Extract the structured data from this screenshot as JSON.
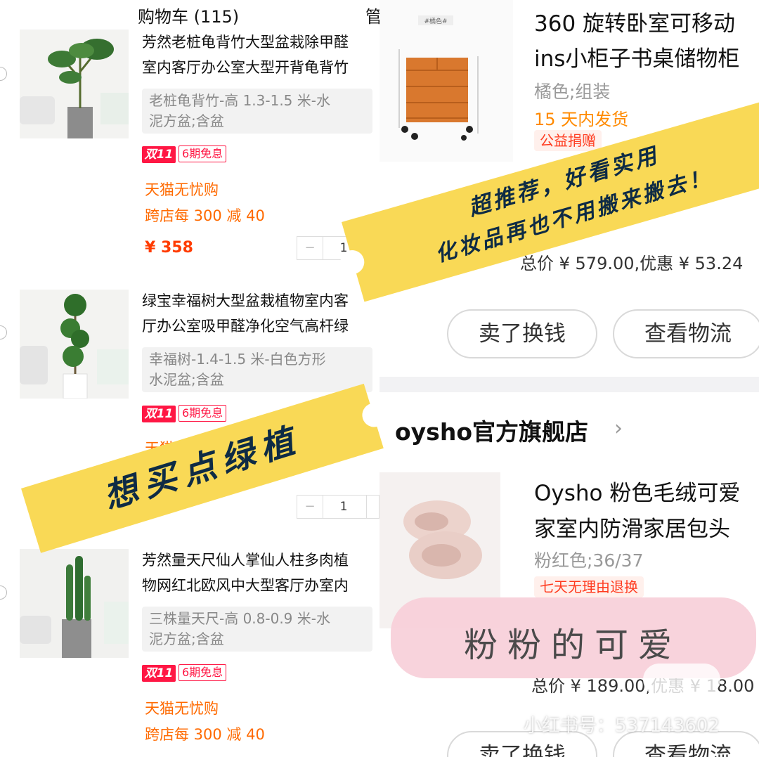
{
  "cart": {
    "title": "购物车 (115)",
    "manage": "管",
    "items": [
      {
        "title_line1": "芳然老桩龟背竹大型盆栽除甲醛",
        "title_line2": "室内客厅办公室大型开背龟背竹",
        "sku_line1": "老桩龟背竹-高 1.3-1.5 米-水",
        "sku_line2": "泥方盆;含盆",
        "tag_d11": "双11",
        "tag_period": "6期免息",
        "promo1": "天猫无忧购",
        "promo2": "跨店每 300 减 40",
        "price": "¥ 358",
        "qty": "1"
      },
      {
        "title_line1": "绿宝幸福树大型盆栽植物室内客",
        "title_line2": "厅办公室吸甲醛净化空气高杆绿",
        "sku_line1": "幸福树-1.4-1.5 米-白色方形",
        "sku_line2": "水泥盆;含盆",
        "tag_d11": "双11",
        "tag_period": "6期免息",
        "promo1": "天猫无忧购",
        "qty": "1"
      },
      {
        "title_line1": "芳然量天尺仙人掌仙人柱多肉植",
        "title_line2": "物网红北欧风中大型客厅办室内",
        "sku_line1": "三株量天尺-高 0.8-0.9 米-水",
        "sku_line2": "泥方盆;含盆",
        "tag_d11": "双11",
        "tag_period": "6期免息",
        "promo1": "天猫无忧购",
        "promo2": "跨店每 300 减 40"
      }
    ]
  },
  "orders": {
    "order1": {
      "product_image_label": "#橘色#",
      "title_line1": "360 旋转卧室可移动",
      "title_line2": "ins小柜子书桌储物柜",
      "spec": "橘色;组装",
      "ship": "15 天内发货",
      "badge": "公益捐赠",
      "total": "总价 ¥ 579.00,优惠 ¥ 53.24",
      "btn_sell": "卖了换钱",
      "btn_logistics": "查看物流"
    },
    "shop_name": "oysho官方旗舰店",
    "order2": {
      "title_line1": "Oysho 粉色毛绒可爱",
      "title_line2": "家室内防滑家居包头",
      "spec": "粉红色;36/37",
      "badge": "七天无理由退换",
      "total": "总价 ¥ 189.00,优惠 ¥ 18.00",
      "btn_sell": "卖了换钱",
      "btn_logistics": "查看物流"
    }
  },
  "overlays": {
    "banner_top_line1": "超推荐，好看实用",
    "banner_top_line2": "化妆品再也不用搬来搬去！",
    "banner_left": "想买点绿植",
    "pink_caption": "粉粉的可爱",
    "watermark": "小红书号：537143602"
  },
  "colors": {
    "price_red": "#ff3b00",
    "promo_orange": "#ff6a00",
    "d11_red": "#ff1744",
    "banner_yellow": "#f9d956",
    "banner_text": "#0e2b45",
    "pink_highlight": "#f7cfd9"
  }
}
